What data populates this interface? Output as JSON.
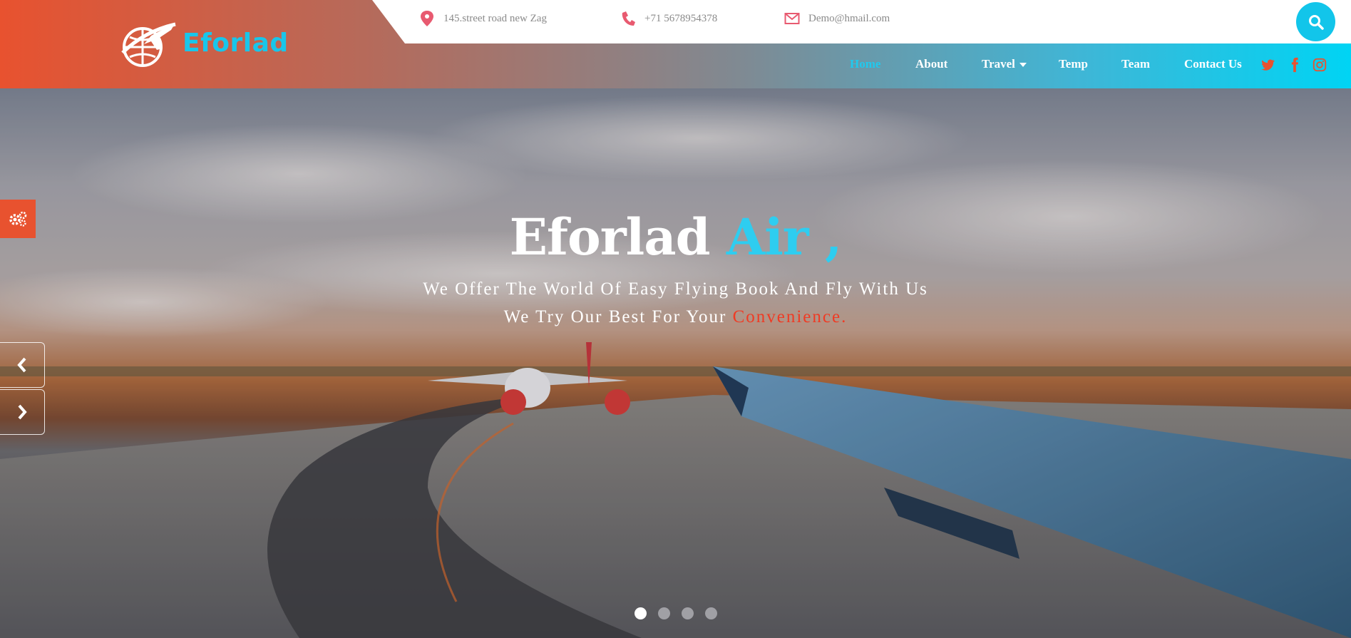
{
  "brand": {
    "name": "Eforlad",
    "logo_icon": "plane-globe-icon"
  },
  "topbar": {
    "address": {
      "icon": "map-pin-icon",
      "text": "145.street road new Zag"
    },
    "phone": {
      "icon": "phone-icon",
      "text": "+71 5678954378"
    },
    "email": {
      "icon": "envelope-icon",
      "text": "Demo@hmail.com"
    },
    "search_icon": "search-icon"
  },
  "nav": {
    "items": [
      {
        "label": "Home",
        "active": true
      },
      {
        "label": "About"
      },
      {
        "label": "Travel",
        "dropdown": true
      },
      {
        "label": "Temp"
      },
      {
        "label": "Team"
      },
      {
        "label": "Contact Us"
      }
    ],
    "social": [
      "twitter-icon",
      "facebook-icon",
      "instagram-icon"
    ]
  },
  "hero": {
    "title_white": "Eforlad",
    "title_blue": "Air ,",
    "line1": "We Offer The World Of Easy Flying Book And Fly With Us",
    "line2_prefix": "We Try Our Best For Your",
    "line2_highlight": "Convenience.",
    "slide_count": 4,
    "active_slide": 1
  },
  "colors": {
    "accent_blue": "#12c5ea",
    "accent_orange": "#e8522f",
    "accent_red": "#ef3b24",
    "icon_pink": "#e85a70"
  }
}
